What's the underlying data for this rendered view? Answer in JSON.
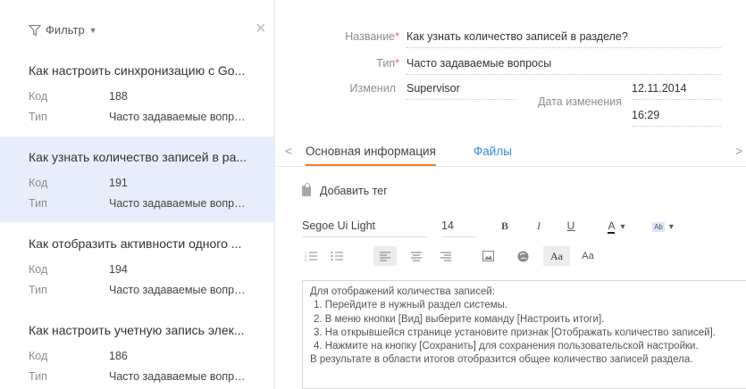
{
  "filter": {
    "label": "Фильтр",
    "close": "×"
  },
  "list": [
    {
      "title": "Как настроить синхронизацию с Go...",
      "code_label": "Код",
      "code": "188",
      "type_label": "Тип",
      "type": "Часто задаваемые вопро..."
    },
    {
      "title": "Как узнать количество записей в ра...",
      "code_label": "Код",
      "code": "191",
      "type_label": "Тип",
      "type": "Часто задаваемые вопро..."
    },
    {
      "title": "Как отобразить активности одного ...",
      "code_label": "Код",
      "code": "194",
      "type_label": "Тип",
      "type": "Часто задаваемые вопро..."
    },
    {
      "title": "Как настроить учетную запись элек...",
      "code_label": "Код",
      "code": "186",
      "type_label": "Тип",
      "type": "Часто задаваемые вопро..."
    }
  ],
  "form": {
    "name_label": "Название",
    "name_value": "Как узнать количество записей в разделе?",
    "type_label": "Тип",
    "type_value": "Часто задаваемые вопросы",
    "modified_by_label": "Изменил",
    "modified_by_value": "Supervisor",
    "modified_date_label": "Дата изменения",
    "modified_date": "12.11.2014",
    "modified_time": "16:29",
    "required_mark": "*"
  },
  "tabs": {
    "left_arrow": "<",
    "right_arrow": ">",
    "items": [
      "Основная информация",
      "Файлы"
    ]
  },
  "tag_button": "Добавить тег",
  "toolbar": {
    "font_family": "Segoe Ui Light",
    "font_size": "14",
    "bold": "B",
    "italic": "I",
    "underline": "U",
    "font_color": "A",
    "highlight": "Ab",
    "caret": "▾",
    "style1": "Aa",
    "style2": "Aa"
  },
  "editor_lines": [
    "Для отображений количества записей:",
    "  1. Перейдите в нужный раздел системы.",
    "  2. В меню кнопки [Вид] выберите команду [Настроить итоги].",
    "  3. На открывшейся странице установите признак [Отображать количество записей].",
    "  4. Нажмите на кнопку [Сохранить] для сохранения пользовательской настройки.",
    "В результате в области итогов отобразится общее количество записей раздела."
  ],
  "colors": {
    "accent_orange": "#f47b30",
    "link_blue": "#2f8be1",
    "selected_row": "#e7eefb",
    "required": "#e86b6b"
  }
}
